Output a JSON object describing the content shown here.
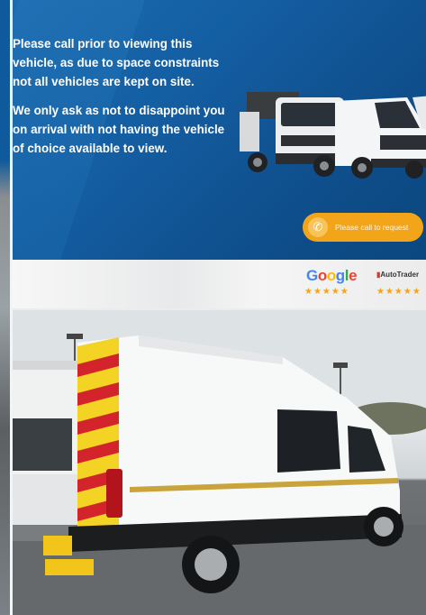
{
  "banner": {
    "paragraph_1": "Please call prior to viewing this vehicle, as due to space constraints not all vehicles are kept on site.",
    "paragraph_2": "We only ask as not to disappoint you on arrival with not having the vehicle of choice available to view.",
    "cta_label": "Please call to request",
    "cta_icon": "phone-icon",
    "colors": {
      "background": "#145fa3",
      "cta": "#f3a519",
      "text": "#ffffff"
    }
  },
  "ratings": {
    "google_label": "Google",
    "google_stars": "★★★★★",
    "autotrader_label": "AutoTrader",
    "autotrader_stars": "★★★★★",
    "colors": {
      "stars": "#f2a51a"
    }
  },
  "photo": {
    "subject": "high roof van"
  }
}
